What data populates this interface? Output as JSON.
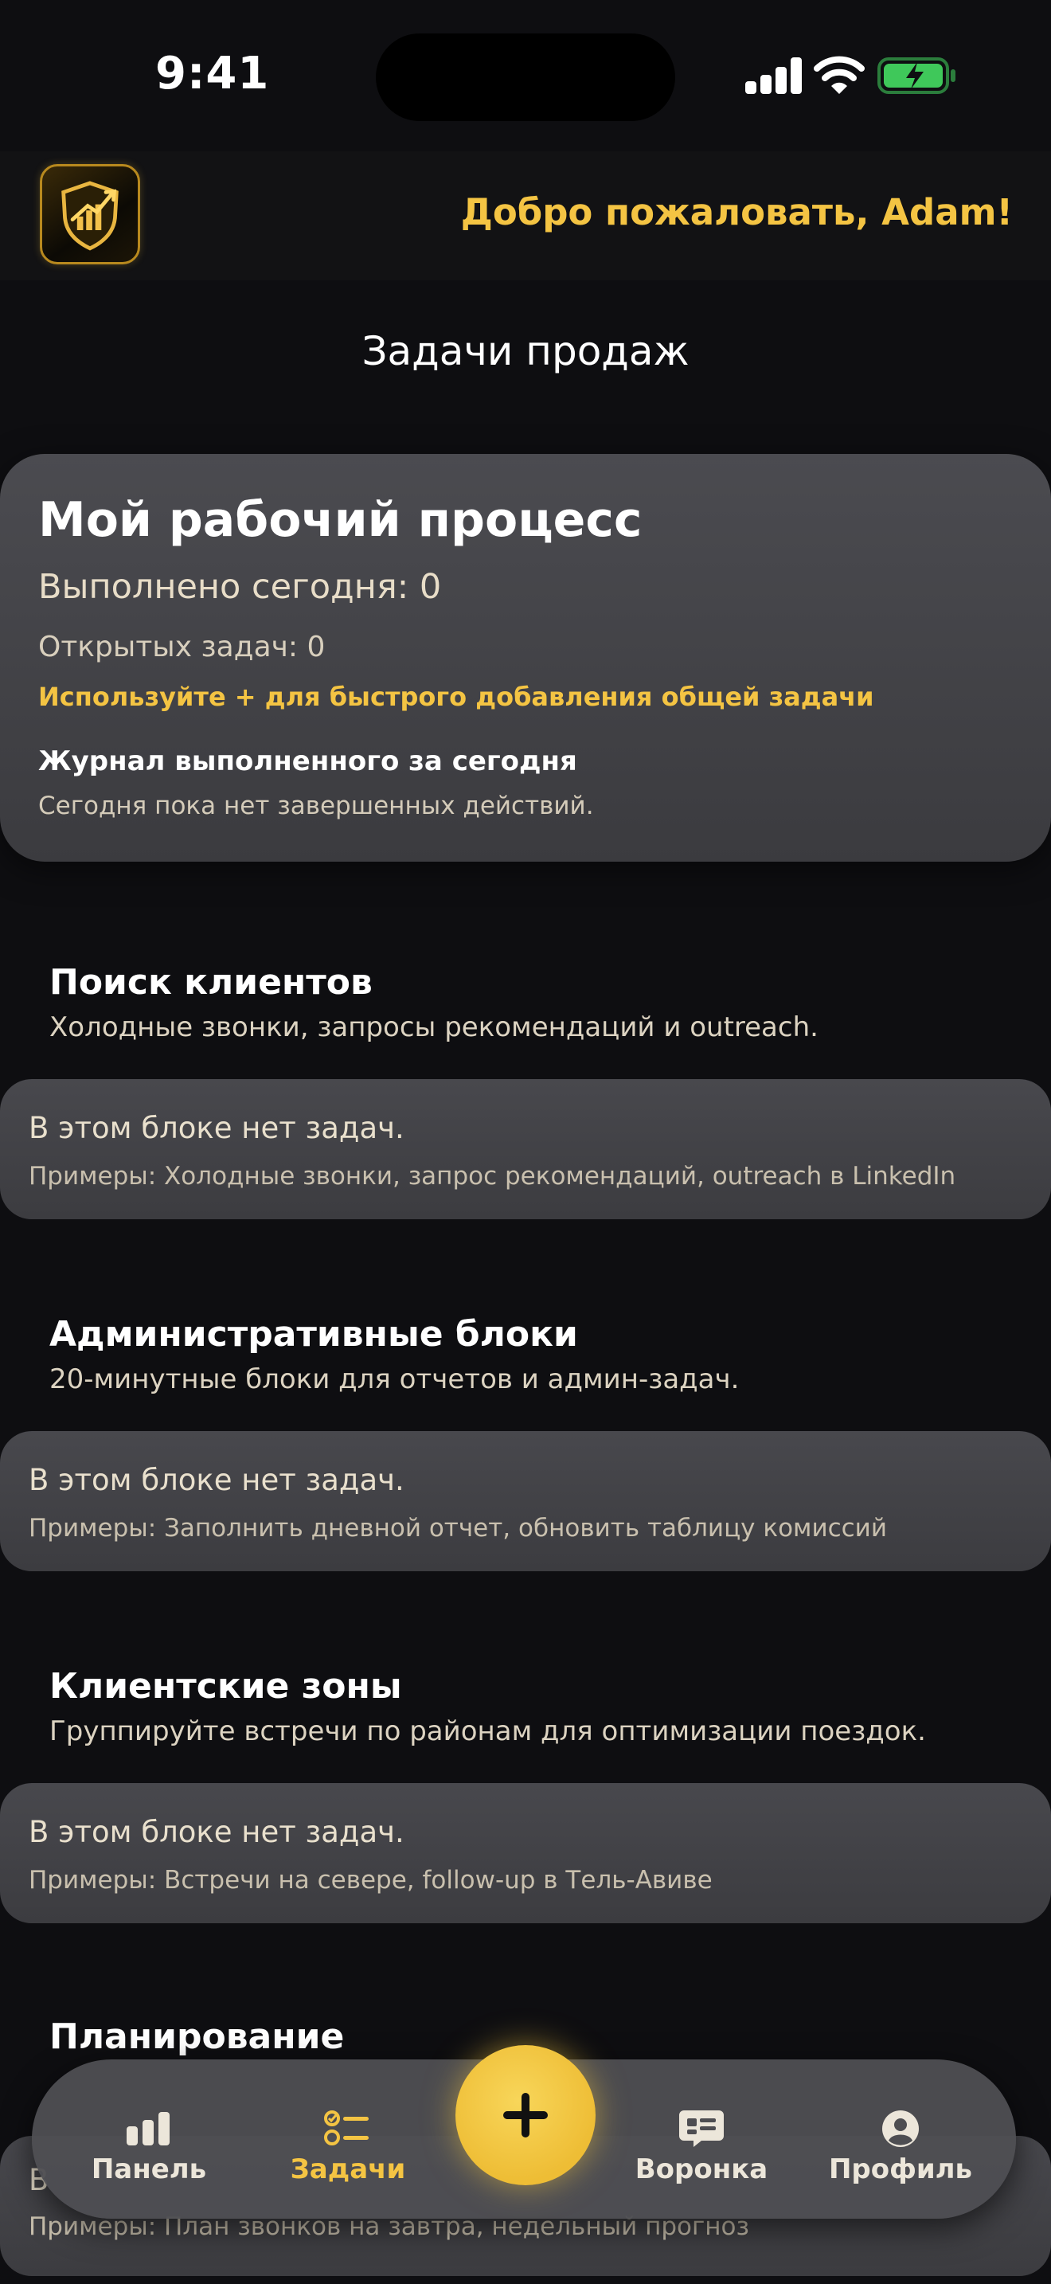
{
  "status_bar": {
    "time": "9:41"
  },
  "header": {
    "welcome": "Добро пожаловать, Adam!"
  },
  "page": {
    "title": "Задачи продаж"
  },
  "workflow": {
    "title": "Мой рабочий процесс",
    "done_today": "Выполнено сегодня: 0",
    "open_tasks": "Открытых задач: 0",
    "hint": "Используйте + для быстрого добавления общей задачи",
    "log_title": "Журнал выполненного за сегодня",
    "log_empty": "Сегодня пока нет завершенных действий."
  },
  "sections": [
    {
      "title": "Поиск клиентов",
      "description": "Холодные звонки, запросы рекомендаций и outreach.",
      "empty_title": "В этом блоке нет задач.",
      "examples": "Примеры: Холодные звонки, запрос рекомендаций, outreach в LinkedIn"
    },
    {
      "title": "Административные блоки",
      "description": "20-минутные блоки для отчетов и админ-задач.",
      "empty_title": "В этом блоке нет задач.",
      "examples": "Примеры: Заполнить дневной отчет, обновить таблицу комиссий"
    },
    {
      "title": "Клиентские зоны",
      "description": "Группируйте встречи по районам для оптимизации поездок.",
      "empty_title": "В этом блоке нет задач.",
      "examples": "Примеры: Встречи на севере, follow-up в Тель-Авиве"
    },
    {
      "title": "Планирование",
      "description": "",
      "empty_title": "В",
      "examples": "Примеры: План звонков на завтра, недельный прогноз"
    }
  ],
  "tab_bar": {
    "items": [
      {
        "label": "Панель",
        "icon": "bar-chart-icon"
      },
      {
        "label": "Задачи",
        "icon": "task-list-icon",
        "active": true
      },
      {
        "label": "Воронка",
        "icon": "chat-bubble-icon"
      },
      {
        "label": "Профиль",
        "icon": "profile-icon"
      }
    ],
    "fab_icon": "plus-icon"
  },
  "colors": {
    "accent": "#f4c443",
    "background": "#0e0e11",
    "card": "#424246"
  }
}
